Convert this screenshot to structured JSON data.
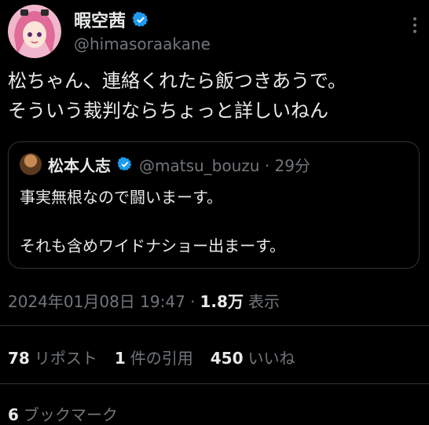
{
  "author": {
    "display_name": "暇空茜",
    "handle": "@himasoraakane",
    "verified_color": "#1d9bf0"
  },
  "tweet": {
    "lines": [
      "松ちゃん、連絡くれたら飯つきあうで。",
      "そういう裁判ならちょっと詳しいねん"
    ]
  },
  "quoted_tweet": {
    "display_name": "松本人志",
    "handle_time": "@matsu_bouzu · 29分",
    "line1": "事実無根なので闘いまーす。",
    "line2": "それも含めワイドナショー出まーす。"
  },
  "meta": {
    "timestamp": "2024年01月08日 19:47 ·",
    "views_count": "1.8万",
    "views_label": "表示"
  },
  "stats": {
    "reposts_count": "78",
    "reposts_label": "リポスト",
    "quotes_count": "1",
    "quotes_label": "件の引用",
    "likes_count": "450",
    "likes_label": "いいね",
    "bookmarks_count": "6",
    "bookmarks_label": "ブックマーク"
  },
  "colors": {
    "background": "#000000",
    "text_primary": "#e7e9ea",
    "text_secondary": "#71767b",
    "border": "#2f3336",
    "accent": "#1d9bf0"
  }
}
